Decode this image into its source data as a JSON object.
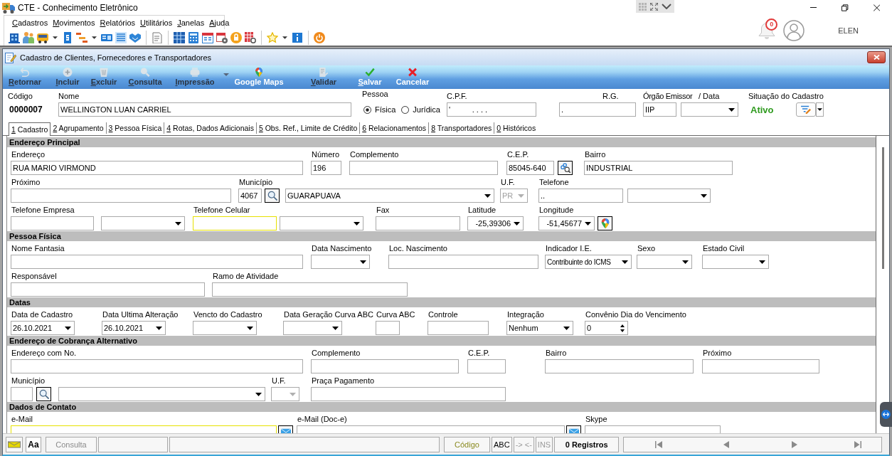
{
  "app": {
    "title": "CTE - Conhecimento Eletrônico",
    "notifications": "0",
    "user": "ELEN"
  },
  "menu": [
    "Cadastros",
    "Movimentos",
    "Relatórios",
    "Utilitários",
    "Janelas",
    "Ajuda"
  ],
  "window": {
    "title": "Cadastro de Clientes, Fornecedores e Transportadores"
  },
  "actions": [
    {
      "label": "Retornar",
      "disabled": true,
      "shortcut": true,
      "menu": false
    },
    {
      "label": "Incluir",
      "disabled": true,
      "shortcut": true,
      "menu": false
    },
    {
      "label": "Excluir",
      "disabled": true,
      "shortcut": true,
      "menu": false
    },
    {
      "label": "Consulta",
      "disabled": true,
      "shortcut": true,
      "menu": false
    },
    {
      "label": "Impressão",
      "disabled": true,
      "shortcut": true,
      "menu": true
    },
    {
      "label": "Google Maps",
      "disabled": false,
      "shortcut": false,
      "menu": false
    },
    {
      "label": "Validar",
      "disabled": true,
      "shortcut": true,
      "menu": false
    },
    {
      "label": "Salvar",
      "disabled": false,
      "shortcut": true,
      "menu": false
    },
    {
      "label": "Cancelar",
      "disabled": false,
      "shortcut": false,
      "menu": false
    }
  ],
  "header": {
    "code": {
      "label": "Código",
      "value": "0000007"
    },
    "name": {
      "label": "Nome",
      "value": "WELLINGTON LUAN CARRIEL"
    },
    "person": {
      "label": "Pessoa",
      "options": [
        {
          "label": "Física",
          "selected": true
        },
        {
          "label": "Jurídica",
          "selected": false
        }
      ]
    },
    "cpf": {
      "label": "C.P.F.",
      "value": "'          . . . ."
    },
    "rg": {
      "label": "R.G.",
      "value": "."
    },
    "issuer": {
      "label": "Órgão Emissor",
      "value": "IIP"
    },
    "issue_date": {
      "label": "/ Data"
    },
    "status": {
      "label": "Situação do Cadastro",
      "value": "Ativo"
    }
  },
  "tabs": [
    {
      "label": "1 Cadastro",
      "selected": true
    },
    {
      "label": "2 Agrupamento",
      "selected": false
    },
    {
      "label": "3 Pessoa Física",
      "selected": false
    },
    {
      "label": "4 Rotas, Dados Adicionais",
      "selected": false
    },
    {
      "label": "5 Obs. Ref., Limite de Crédito",
      "selected": false
    },
    {
      "label": "6 Relacionamentos",
      "selected": false
    },
    {
      "label": "8 Transportadores",
      "selected": false
    },
    {
      "label": "0 Históricos",
      "selected": false
    }
  ],
  "sections": [
    {
      "title": "Endereço Principal",
      "rows": [
        {
          "fields": [
            {
              "kind": "text",
              "label": "Endereço",
              "value": "RUA MARIO VIRMOND",
              "highlighted": false
            },
            {
              "kind": "text",
              "label": "Número",
              "value": "196",
              "highlighted": false
            },
            {
              "kind": "text",
              "label": "Complemento",
              "highlighted": false
            },
            {
              "kind": "text",
              "label": "C.E.P.",
              "value": "85045-640",
              "highlighted": false
            },
            {
              "kind": "cep-button"
            },
            {
              "kind": "text",
              "label": "Bairro",
              "value": "INDUSTRIAL",
              "highlighted": false
            }
          ]
        },
        {
          "fields": [
            {
              "kind": "text",
              "label": "Próximo",
              "highlighted": false
            },
            {
              "kind": "text",
              "label": "Município",
              "value": "4067",
              "highlighted": false
            },
            {
              "kind": "search-button"
            },
            {
              "kind": "select",
              "value": "GUARAPUAVA",
              "disabled": false
            },
            {
              "kind": "select",
              "label": "U.F.",
              "value": "PR",
              "disabled": true
            },
            {
              "kind": "text",
              "label": "Telefone",
              "value": "..",
              "highlighted": false
            },
            {
              "kind": "select",
              "disabled": false
            }
          ]
        },
        {
          "fields": [
            {
              "kind": "text",
              "label": "Telefone Empresa",
              "highlighted": false
            },
            {
              "kind": "select",
              "disabled": false
            },
            {
              "kind": "text",
              "label": "Telefone Celular",
              "highlighted": true
            },
            {
              "kind": "select",
              "disabled": false
            },
            {
              "kind": "text",
              "label": "Fax",
              "highlighted": false
            },
            {
              "kind": "number-select",
              "label": "Latitude",
              "value": "-25,39306"
            },
            {
              "kind": "number-select",
              "label": "Longitude",
              "value": "-51,45677"
            },
            {
              "kind": "map-button"
            }
          ]
        }
      ]
    },
    {
      "title": "Pessoa Física",
      "rows": [
        {
          "fields": [
            {
              "kind": "text",
              "label": "Nome Fantasia",
              "highlighted": false
            },
            {
              "kind": "select",
              "label": "Data Nascimento",
              "disabled": false
            },
            {
              "kind": "text",
              "label": "Loc. Nascimento",
              "highlighted": false
            },
            {
              "kind": "select",
              "label": "Indicador I.E.",
              "value": "Contribuinte do ICMS",
              "disabled": false
            },
            {
              "kind": "select",
              "label": "Sexo",
              "disabled": false
            },
            {
              "kind": "select",
              "label": "Estado Civil",
              "disabled": false
            }
          ]
        },
        {
          "fields": [
            {
              "kind": "text",
              "label": "Responsável",
              "highlighted": false
            },
            {
              "kind": "text",
              "label": "Ramo de Atividade",
              "highlighted": false
            }
          ]
        }
      ]
    },
    {
      "title": "Datas",
      "rows": [
        {
          "fields": [
            {
              "kind": "select",
              "label": "Data de Cadastro",
              "value": "26.10.2021",
              "disabled": false
            },
            {
              "kind": "select",
              "label": "Data Ultima Alteração",
              "value": "26.10.2021",
              "disabled": false
            },
            {
              "kind": "select",
              "label": "Vencto do Cadastro",
              "disabled": false
            },
            {
              "kind": "select",
              "label": "Data Geração Curva ABC",
              "disabled": false
            },
            {
              "kind": "text",
              "label": "Curva ABC",
              "highlighted": false
            },
            {
              "kind": "text",
              "label": "Controle",
              "highlighted": false
            },
            {
              "kind": "select",
              "label": "Integração",
              "value": "Nenhum",
              "disabled": false
            },
            {
              "kind": "spin",
              "label": "Convênio Dia do Vencimento",
              "value": "0"
            }
          ]
        }
      ]
    },
    {
      "title": "Endereço de Cobrança Alternativo",
      "rows": [
        {
          "fields": [
            {
              "kind": "text",
              "label": "Endereço com No.",
              "highlighted": false
            },
            {
              "kind": "text",
              "label": "Complemento",
              "highlighted": false
            },
            {
              "kind": "text",
              "label": "C.E.P.",
              "highlighted": false
            },
            {
              "kind": "text",
              "label": "Bairro",
              "highlighted": false
            },
            {
              "kind": "text",
              "label": "Próximo",
              "highlighted": false
            }
          ]
        },
        {
          "fields": [
            {
              "kind": "text",
              "label": "Município",
              "highlighted": false
            },
            {
              "kind": "search-button"
            },
            {
              "kind": "select",
              "disabled": false
            },
            {
              "kind": "select",
              "label": "U.F.",
              "disabled": true
            },
            {
              "kind": "text",
              "label": "Praça Pagamento",
              "highlighted": false
            }
          ]
        }
      ]
    },
    {
      "title": "Dados de Contato",
      "rows": [
        {
          "fields": [
            {
              "kind": "text",
              "label": "e-Mail",
              "highlighted": true
            },
            {
              "kind": "mail-button"
            },
            {
              "kind": "text",
              "label": "e-Mail (Doc-e)",
              "highlighted": false
            },
            {
              "kind": "mail-button"
            },
            {
              "kind": "text",
              "label": "Skype",
              "highlighted": false
            }
          ]
        }
      ]
    }
  ],
  "status_bar": {
    "font_button": "Aa",
    "cells": [
      {
        "kind": "mode",
        "text": "Consulta"
      },
      {
        "kind": "key",
        "text": "Código"
      },
      {
        "kind": "flag",
        "text": "ABC",
        "on": true
      },
      {
        "kind": "flag",
        "text": "-> <-",
        "on": false
      },
      {
        "kind": "flag",
        "text": "INS",
        "on": false
      },
      {
        "kind": "count",
        "text": "0 Registros"
      }
    ]
  }
}
